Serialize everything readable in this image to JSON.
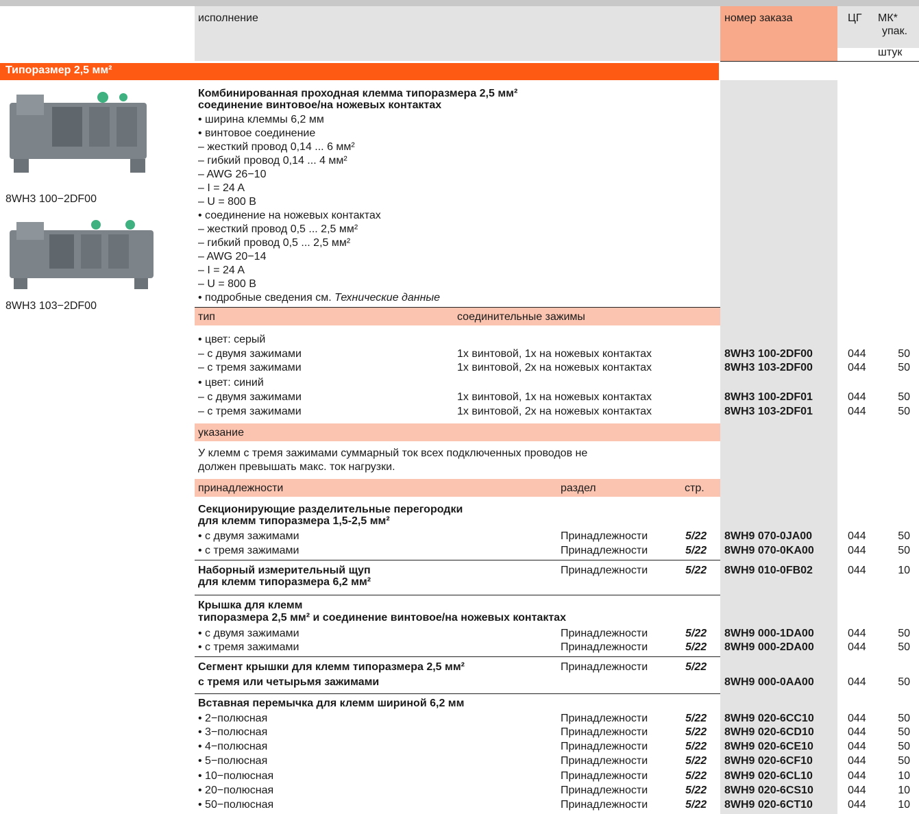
{
  "header": {
    "col_design": "исполнение",
    "col_order": "номер заказа",
    "col_pg": "ЦГ",
    "col_pu1": "МК*",
    "col_pu2": "упак.",
    "col_unit": "штук"
  },
  "section_title": "Типоразмер 2,5 мм²",
  "images": [
    {
      "caption": "8WH3 100−2DF00"
    },
    {
      "caption": "8WH3 103−2DF00"
    }
  ],
  "product": {
    "title1": "Комбинированная проходная клемма типоразмера 2,5 мм²",
    "title2": "соединение винтовое/на ножевых контактах",
    "specs": [
      "• ширина клеммы 6,2 мм",
      "• винтовое соединение",
      "– жесткий провод 0,14 ... 6 мм²",
      "– гибкий провод 0,14 ... 4 мм²",
      "– AWG 26−10",
      "– I = 24 A",
      "– U = 800 В",
      "• соединение на ножевых контактах",
      "– жесткий провод 0,5 ... 2,5 мм²",
      "– гибкий провод 0,5 ... 2,5 мм²",
      "– AWG 20−14",
      "– I = 24 A",
      "– U = 800 В"
    ],
    "details_prefix": "• подробные сведения см. ",
    "details_link": "Технические данные"
  },
  "type_header": {
    "c1": "тип",
    "c2": "соединительные зажимы"
  },
  "variants": [
    {
      "label": "• цвет: серый"
    },
    {
      "label": "– с двумя зажимами",
      "conn": "1x винтовой, 1x на ножевых контактах",
      "order": "8WH3 100-2DF00",
      "pg": "044",
      "pu": "50"
    },
    {
      "label": "– с тремя зажимами",
      "conn": "1x винтовой, 2x на ножевых контактах",
      "order": "8WH3 103-2DF00",
      "pg": "044",
      "pu": "50"
    },
    {
      "label": "• цвет: синий"
    },
    {
      "label": "– с двумя зажимами",
      "conn": "1x винтовой, 1x на ножевых контактах",
      "order": "8WH3 100-2DF01",
      "pg": "044",
      "pu": "50"
    },
    {
      "label": "– с тремя зажимами",
      "conn": "1x винтовой, 2x на ножевых контактах",
      "order": "8WH3 103-2DF01",
      "pg": "044",
      "pu": "50"
    }
  ],
  "note": {
    "header": "указание",
    "line1": "У клемм с тремя зажимами  суммарный ток всех подключенных проводов не",
    "line2": "должен превышать макс. ток нагрузки."
  },
  "acc_header": {
    "c1": "принадлежности",
    "c2": "раздел",
    "c3": "стр."
  },
  "accessories": [
    {
      "title1": "Секционирующие разделительные перегородки",
      "title2": "для клемм типоразмера 1,5-2,5 мм²",
      "rows": [
        {
          "label": "• с двумя зажимами",
          "section": "Принадлежности",
          "page": "5/22",
          "order": "8WH9 070-0JA00",
          "pg": "044",
          "pu": "50"
        },
        {
          "label": "• с тремя зажимами",
          "section": "Принадлежности",
          "page": "5/22",
          "order": "8WH9 070-0KA00",
          "pg": "044",
          "pu": "50"
        }
      ]
    },
    {
      "title1": "Наборный измерительный щуп",
      "title2": "для клемм типоразмера 6,2 мм²",
      "section": "Принадлежности",
      "page": "5/22",
      "order": "8WH9 010-0FB02",
      "pg": "044",
      "pu": "10"
    },
    {
      "title1": "Крышка для клемм",
      "title2": "типоразмера 2,5 мм² и соединение винтовое/на ножевых контактах",
      "rows": [
        {
          "label": "• с двумя зажимами",
          "section": "Принадлежности",
          "page": "5/22",
          "order": "8WH9 000-1DA00",
          "pg": "044",
          "pu": "50"
        },
        {
          "label": "• с тремя зажимами",
          "section": "Принадлежности",
          "page": "5/22",
          "order": "8WH9 000-2DA00",
          "pg": "044",
          "pu": "50"
        }
      ]
    },
    {
      "title1": "Сегмент крышки для клемм типоразмера 2,5 мм²",
      "title2": "с тремя или четырьмя зажимами",
      "section": "Принадлежности",
      "page": "5/22",
      "order": "8WH9 000-0AA00",
      "pg": "044",
      "pu": "50"
    },
    {
      "title1": "Вставная перемычка для клемм шириной 6,2 мм",
      "rows": [
        {
          "label": "• 2−полюсная",
          "section": "Принадлежности",
          "page": "5/22",
          "order": "8WH9 020-6CC10",
          "pg": "044",
          "pu": "50"
        },
        {
          "label": "• 3−полюсная",
          "section": "Принадлежности",
          "page": "5/22",
          "order": "8WH9 020-6CD10",
          "pg": "044",
          "pu": "50"
        },
        {
          "label": "• 4−полюсная",
          "section": "Принадлежности",
          "page": "5/22",
          "order": "8WH9 020-6CE10",
          "pg": "044",
          "pu": "50"
        },
        {
          "label": "• 5−полюсная",
          "section": "Принадлежности",
          "page": "5/22",
          "order": "8WH9 020-6CF10",
          "pg": "044",
          "pu": "50"
        },
        {
          "label": "• 10−полюсная",
          "section": "Принадлежности",
          "page": "5/22",
          "order": "8WH9 020-6CL10",
          "pg": "044",
          "pu": "10"
        },
        {
          "label": "• 20−полюсная",
          "section": "Принадлежности",
          "page": "5/22",
          "order": "8WH9 020-6CS10",
          "pg": "044",
          "pu": "10"
        },
        {
          "label": "• 50−полюсная",
          "section": "Принадлежности",
          "page": "5/22",
          "order": "8WH9 020-6CT10",
          "pg": "044",
          "pu": "10"
        }
      ]
    }
  ]
}
